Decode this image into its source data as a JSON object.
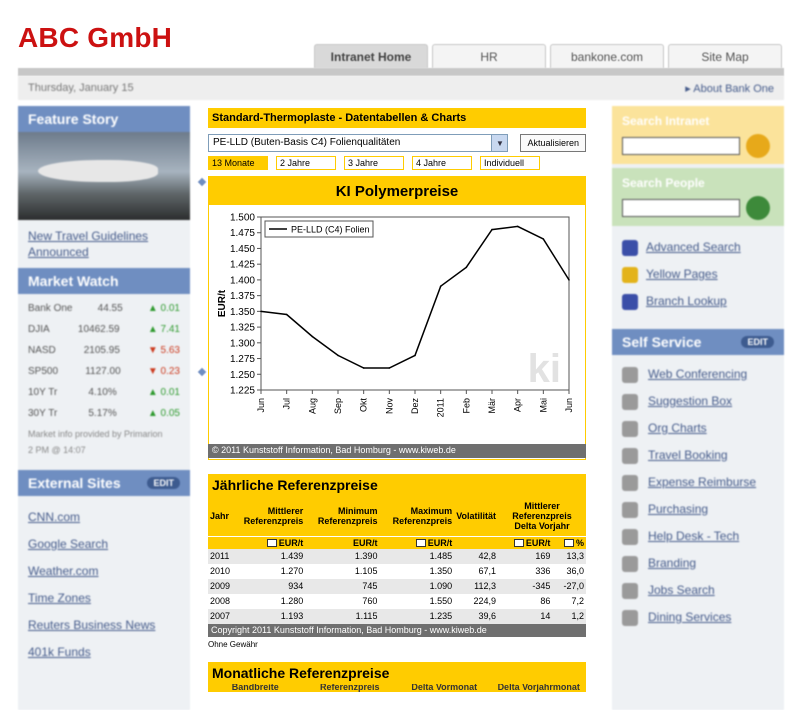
{
  "brand": "ABC GmbH",
  "topnav": [
    "Intranet Home",
    "HR",
    "bankone.com",
    "Site Map"
  ],
  "datebar": {
    "date": "Thursday, January 15",
    "about": "About Bank One"
  },
  "left": {
    "feature_title": "Feature Story",
    "feature_link": "New Travel Guidelines Announced",
    "market_title": "Market Watch",
    "market_rows": [
      {
        "name": "Bank One",
        "value": "44.55",
        "change": "0.01",
        "dir": "up"
      },
      {
        "name": "DJIA",
        "value": "10462.59",
        "change": "7.41",
        "dir": "up"
      },
      {
        "name": "NASD",
        "value": "2105.95",
        "change": "5.63",
        "dir": "down"
      },
      {
        "name": "SP500",
        "value": "1127.00",
        "change": "0.23",
        "dir": "down"
      },
      {
        "name": "10Y Tr",
        "value": "4.10%",
        "change": "0.01",
        "dir": "up"
      },
      {
        "name": "30Y Tr",
        "value": "5.17%",
        "change": "0.05",
        "dir": "up"
      }
    ],
    "market_note": "Market info provided by Primarion",
    "market_time": "2 PM @ 14:07",
    "external_title": "External Sites",
    "external_pill": "EDIT",
    "external_links": [
      "CNN.com",
      "Google Search",
      "Weather.com",
      "Time Zones",
      "Reuters Business News",
      "401k Funds"
    ]
  },
  "right": {
    "search_intranet": "Search Intranet",
    "search_people": "Search People",
    "links": [
      {
        "label": "Advanced Search",
        "icon": "question-icon",
        "color": "#3a4ea8"
      },
      {
        "label": "Yellow Pages",
        "icon": "person-icon",
        "color": "#e3b31a"
      },
      {
        "label": "Branch Lookup",
        "icon": "car-icon",
        "color": "#3a4ea8"
      }
    ],
    "self_service_title": "Self Service",
    "self_service_pill": "EDIT",
    "self_service": [
      "Web Conferencing",
      "Suggestion Box",
      "Org Charts",
      "Travel Booking",
      "Expense Reimburse",
      "Purchasing",
      "Help Desk - Tech",
      "Branding",
      "Jobs Search",
      "Dining Services"
    ]
  },
  "main": {
    "title": "Standard-Thermoplaste - Datentabellen & Charts",
    "select_value": "PE-LLD (Buten-Basis C4) Folienqualitäten",
    "update_button": "Aktualisieren",
    "tabs": [
      "13 Monate",
      "2 Jahre",
      "3 Jahre",
      "4 Jahre",
      "Individuell"
    ],
    "active_tab": 0,
    "chart_copyright": "© 2011 Kunststoff Information, Bad Homburg - www.kiweb.de",
    "table_title": "Jährliche Referenzpreise",
    "table_headers": [
      "Jahr",
      "Mittlerer Referenzpreis",
      "Minimum Referenzpreis",
      "Maximum Referenzpreis",
      "Volatilität",
      "Mittlerer Referenzpreis Delta Vorjahr"
    ],
    "unit_eur": "EUR/t",
    "unit_pct": "%",
    "table_rows": [
      [
        "2011",
        "1.439",
        "1.390",
        "1.485",
        "42,8",
        "169",
        "13,3"
      ],
      [
        "2010",
        "1.270",
        "1.105",
        "1.350",
        "67,1",
        "336",
        "36,0"
      ],
      [
        "2009",
        "934",
        "745",
        "1.090",
        "112,3",
        "-345",
        "-27,0"
      ],
      [
        "2008",
        "1.280",
        "760",
        "1.550",
        "224,9",
        "86",
        "7,2"
      ],
      [
        "2007",
        "1.193",
        "1.115",
        "1.235",
        "39,6",
        "14",
        "1,2"
      ]
    ],
    "table_copyright": "Copyright 2011 Kunststoff Information, Bad Homburg - www.kiweb.de",
    "disclaimer": "Ohne Gewähr",
    "monthly_title": "Monatliche Referenzpreise",
    "monthly_cols": [
      "Bandbreite",
      "Referenzpreis",
      "Delta Vormonat",
      "Delta Vorjahrmonat"
    ]
  },
  "chart_data": {
    "type": "line",
    "title": "KI Polymerpreise",
    "ylabel": "EUR/t",
    "xlabel": "",
    "categories": [
      "Jun",
      "Jul",
      "Aug",
      "Sep",
      "Okt",
      "Nov",
      "Dez",
      "2011",
      "Feb",
      "Mär",
      "Apr",
      "Mai",
      "Jun"
    ],
    "series": [
      {
        "name": "PE-LLD (C4) Folien",
        "values": [
          1.35,
          1.345,
          1.31,
          1.28,
          1.26,
          1.26,
          1.28,
          1.39,
          1.42,
          1.48,
          1.485,
          1.465,
          1.4
        ]
      }
    ],
    "ylim": [
      1.225,
      1.5
    ],
    "yticks": [
      "1.500",
      "1.475",
      "1.450",
      "1.425",
      "1.400",
      "1.375",
      "1.350",
      "1.325",
      "1.300",
      "1.275",
      "1.250",
      "1.225"
    ],
    "grid": false,
    "legend": "top-left",
    "watermark": "ki",
    "color": "#000000"
  }
}
